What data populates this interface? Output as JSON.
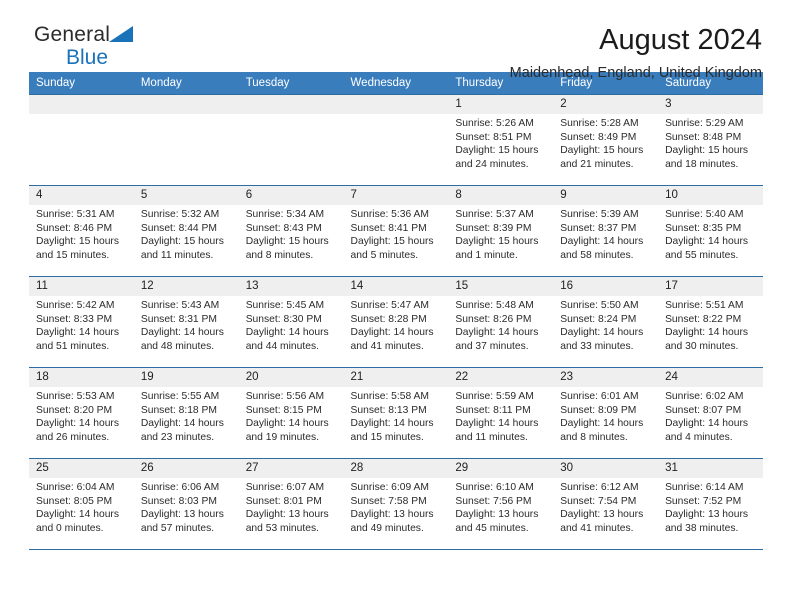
{
  "brand": {
    "line1": "General",
    "line2": "Blue",
    "triangle_color": "#1a72b8",
    "icon": "triangle-flag-icon"
  },
  "header": {
    "title": "August 2024",
    "subtitle": "Maidenhead, England, United Kingdom"
  },
  "theme": {
    "header_blue": "#3a7dbd",
    "rule_blue": "#2e6da4",
    "daynum_bg": "#efefef",
    "brand_blue": "#1a72b8"
  },
  "columns": [
    "Sunday",
    "Monday",
    "Tuesday",
    "Wednesday",
    "Thursday",
    "Friday",
    "Saturday"
  ],
  "weeks": [
    [
      {
        "day": "",
        "empty": true
      },
      {
        "day": "",
        "empty": true
      },
      {
        "day": "",
        "empty": true
      },
      {
        "day": "",
        "empty": true
      },
      {
        "day": "1",
        "sunrise": "Sunrise: 5:26 AM",
        "sunset": "Sunset: 8:51 PM",
        "daylight": "Daylight: 15 hours and 24 minutes."
      },
      {
        "day": "2",
        "sunrise": "Sunrise: 5:28 AM",
        "sunset": "Sunset: 8:49 PM",
        "daylight": "Daylight: 15 hours and 21 minutes."
      },
      {
        "day": "3",
        "sunrise": "Sunrise: 5:29 AM",
        "sunset": "Sunset: 8:48 PM",
        "daylight": "Daylight: 15 hours and 18 minutes."
      }
    ],
    [
      {
        "day": "4",
        "sunrise": "Sunrise: 5:31 AM",
        "sunset": "Sunset: 8:46 PM",
        "daylight": "Daylight: 15 hours and 15 minutes."
      },
      {
        "day": "5",
        "sunrise": "Sunrise: 5:32 AM",
        "sunset": "Sunset: 8:44 PM",
        "daylight": "Daylight: 15 hours and 11 minutes."
      },
      {
        "day": "6",
        "sunrise": "Sunrise: 5:34 AM",
        "sunset": "Sunset: 8:43 PM",
        "daylight": "Daylight: 15 hours and 8 minutes."
      },
      {
        "day": "7",
        "sunrise": "Sunrise: 5:36 AM",
        "sunset": "Sunset: 8:41 PM",
        "daylight": "Daylight: 15 hours and 5 minutes."
      },
      {
        "day": "8",
        "sunrise": "Sunrise: 5:37 AM",
        "sunset": "Sunset: 8:39 PM",
        "daylight": "Daylight: 15 hours and 1 minute."
      },
      {
        "day": "9",
        "sunrise": "Sunrise: 5:39 AM",
        "sunset": "Sunset: 8:37 PM",
        "daylight": "Daylight: 14 hours and 58 minutes."
      },
      {
        "day": "10",
        "sunrise": "Sunrise: 5:40 AM",
        "sunset": "Sunset: 8:35 PM",
        "daylight": "Daylight: 14 hours and 55 minutes."
      }
    ],
    [
      {
        "day": "11",
        "sunrise": "Sunrise: 5:42 AM",
        "sunset": "Sunset: 8:33 PM",
        "daylight": "Daylight: 14 hours and 51 minutes."
      },
      {
        "day": "12",
        "sunrise": "Sunrise: 5:43 AM",
        "sunset": "Sunset: 8:31 PM",
        "daylight": "Daylight: 14 hours and 48 minutes."
      },
      {
        "day": "13",
        "sunrise": "Sunrise: 5:45 AM",
        "sunset": "Sunset: 8:30 PM",
        "daylight": "Daylight: 14 hours and 44 minutes."
      },
      {
        "day": "14",
        "sunrise": "Sunrise: 5:47 AM",
        "sunset": "Sunset: 8:28 PM",
        "daylight": "Daylight: 14 hours and 41 minutes."
      },
      {
        "day": "15",
        "sunrise": "Sunrise: 5:48 AM",
        "sunset": "Sunset: 8:26 PM",
        "daylight": "Daylight: 14 hours and 37 minutes."
      },
      {
        "day": "16",
        "sunrise": "Sunrise: 5:50 AM",
        "sunset": "Sunset: 8:24 PM",
        "daylight": "Daylight: 14 hours and 33 minutes."
      },
      {
        "day": "17",
        "sunrise": "Sunrise: 5:51 AM",
        "sunset": "Sunset: 8:22 PM",
        "daylight": "Daylight: 14 hours and 30 minutes."
      }
    ],
    [
      {
        "day": "18",
        "sunrise": "Sunrise: 5:53 AM",
        "sunset": "Sunset: 8:20 PM",
        "daylight": "Daylight: 14 hours and 26 minutes."
      },
      {
        "day": "19",
        "sunrise": "Sunrise: 5:55 AM",
        "sunset": "Sunset: 8:18 PM",
        "daylight": "Daylight: 14 hours and 23 minutes."
      },
      {
        "day": "20",
        "sunrise": "Sunrise: 5:56 AM",
        "sunset": "Sunset: 8:15 PM",
        "daylight": "Daylight: 14 hours and 19 minutes."
      },
      {
        "day": "21",
        "sunrise": "Sunrise: 5:58 AM",
        "sunset": "Sunset: 8:13 PM",
        "daylight": "Daylight: 14 hours and 15 minutes."
      },
      {
        "day": "22",
        "sunrise": "Sunrise: 5:59 AM",
        "sunset": "Sunset: 8:11 PM",
        "daylight": "Daylight: 14 hours and 11 minutes."
      },
      {
        "day": "23",
        "sunrise": "Sunrise: 6:01 AM",
        "sunset": "Sunset: 8:09 PM",
        "daylight": "Daylight: 14 hours and 8 minutes."
      },
      {
        "day": "24",
        "sunrise": "Sunrise: 6:02 AM",
        "sunset": "Sunset: 8:07 PM",
        "daylight": "Daylight: 14 hours and 4 minutes."
      }
    ],
    [
      {
        "day": "25",
        "sunrise": "Sunrise: 6:04 AM",
        "sunset": "Sunset: 8:05 PM",
        "daylight": "Daylight: 14 hours and 0 minutes."
      },
      {
        "day": "26",
        "sunrise": "Sunrise: 6:06 AM",
        "sunset": "Sunset: 8:03 PM",
        "daylight": "Daylight: 13 hours and 57 minutes."
      },
      {
        "day": "27",
        "sunrise": "Sunrise: 6:07 AM",
        "sunset": "Sunset: 8:01 PM",
        "daylight": "Daylight: 13 hours and 53 minutes."
      },
      {
        "day": "28",
        "sunrise": "Sunrise: 6:09 AM",
        "sunset": "Sunset: 7:58 PM",
        "daylight": "Daylight: 13 hours and 49 minutes."
      },
      {
        "day": "29",
        "sunrise": "Sunrise: 6:10 AM",
        "sunset": "Sunset: 7:56 PM",
        "daylight": "Daylight: 13 hours and 45 minutes."
      },
      {
        "day": "30",
        "sunrise": "Sunrise: 6:12 AM",
        "sunset": "Sunset: 7:54 PM",
        "daylight": "Daylight: 13 hours and 41 minutes."
      },
      {
        "day": "31",
        "sunrise": "Sunrise: 6:14 AM",
        "sunset": "Sunset: 7:52 PM",
        "daylight": "Daylight: 13 hours and 38 minutes."
      }
    ]
  ]
}
